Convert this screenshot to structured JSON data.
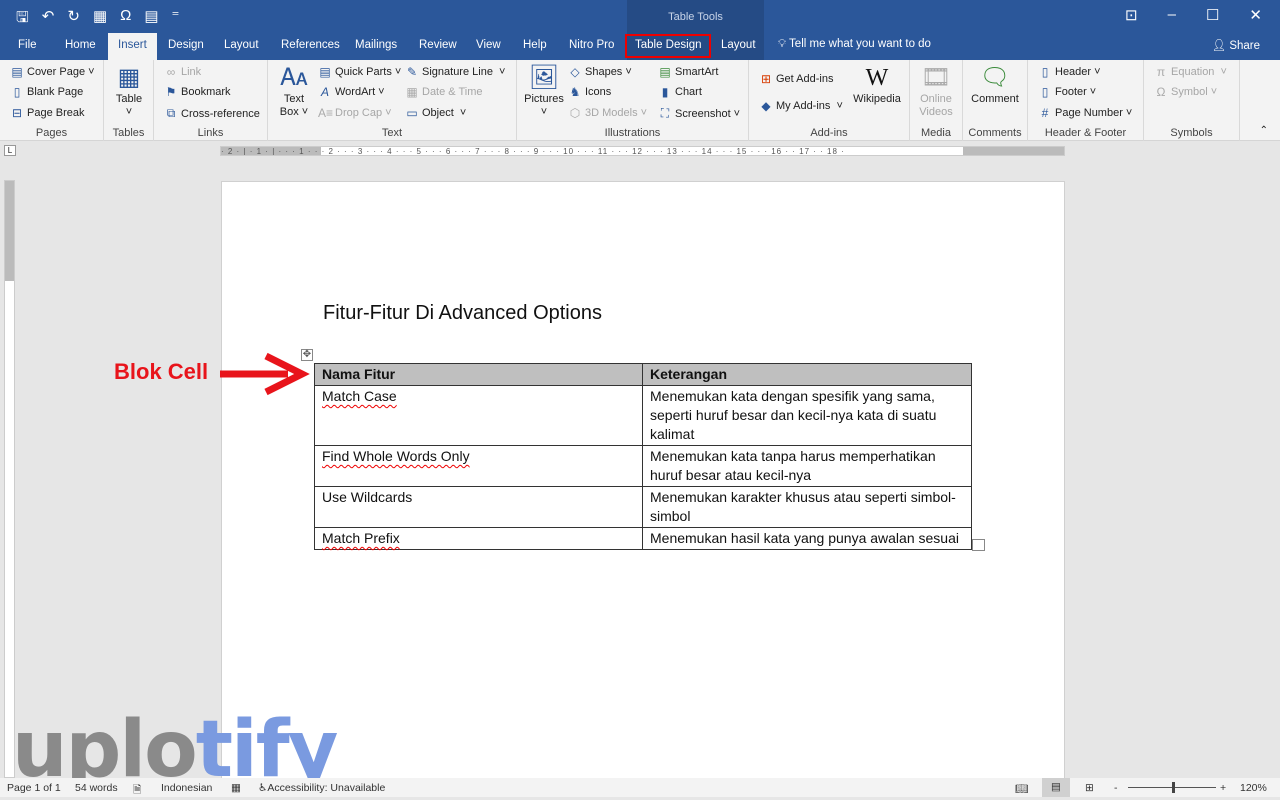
{
  "titlebar": {
    "context_group": "Table Tools",
    "qat": [
      {
        "icon": "save-icon",
        "glyph": "🖫"
      },
      {
        "icon": "undo-icon",
        "glyph": "↶"
      },
      {
        "icon": "redo-icon",
        "glyph": "↻"
      },
      {
        "icon": "table-insert-icon",
        "glyph": "▦"
      },
      {
        "icon": "omega-icon",
        "glyph": "Ω"
      },
      {
        "icon": "document-icon",
        "glyph": "▤"
      },
      {
        "icon": "customize-icon",
        "glyph": "⁼"
      }
    ],
    "window_buttons": [
      {
        "icon": "ribbon-display-icon",
        "glyph": "⊡"
      },
      {
        "icon": "minimize-icon",
        "glyph": "–"
      },
      {
        "icon": "maximize-icon",
        "glyph": "☐"
      },
      {
        "icon": "close-icon",
        "glyph": "✕"
      }
    ]
  },
  "tabs": [
    "File",
    "Home",
    "Insert",
    "Design",
    "Layout",
    "References",
    "Mailings",
    "Review",
    "View",
    "Help",
    "Nitro Pro",
    "Table Design",
    "Layout"
  ],
  "active_tab": "Insert",
  "highlighted_tab": "Table Design",
  "highlight_color": "#e00000",
  "tell_me": "Tell me what you want to do",
  "share": "Share",
  "ribbon": {
    "pages": {
      "label": "Pages",
      "items": [
        "Cover Page",
        "Blank Page",
        "Page Break"
      ]
    },
    "tables": {
      "label": "Tables",
      "items": [
        "Table"
      ]
    },
    "links": {
      "label": "Links",
      "items": [
        "Link",
        "Bookmark",
        "Cross-reference"
      ]
    },
    "text": {
      "label": "Text",
      "items": [
        "Text Box",
        "Quick Parts",
        "WordArt",
        "Drop Cap",
        "Signature Line",
        "Date & Time",
        "Object"
      ]
    },
    "illustrations": {
      "label": "Illustrations",
      "items": [
        "Pictures",
        "Shapes",
        "Icons",
        "3D Models",
        "SmartArt",
        "Chart",
        "Screenshot"
      ]
    },
    "addins": {
      "label": "Add-ins",
      "items": [
        "Get Add-ins",
        "My Add-ins",
        "Wikipedia"
      ]
    },
    "media": {
      "label": "Media",
      "items": [
        "Online Videos"
      ]
    },
    "comments": {
      "label": "Comments",
      "items": [
        "Comment"
      ]
    },
    "header_footer": {
      "label": "Header & Footer",
      "items": [
        "Header",
        "Footer",
        "Page Number"
      ]
    },
    "symbols": {
      "label": "Symbols",
      "items": [
        "Equation",
        "Symbol"
      ]
    }
  },
  "ruler": "· 2 · | · 1 · | · · · 1 · · · 2 · · · 3 · · · 4 · · · 5 · · · 6 · · · 7 · · · 8 · · · 9 · · · 10 · · · 11 · · · 12 · · · 13 · · · 14 · · · 15 · · · 16 · · 17 · · 18 ·",
  "document": {
    "title": "Fitur-Fitur Di Advanced Options",
    "table": {
      "headers": [
        "Nama Fitur",
        "Keterangan"
      ],
      "rows": [
        [
          "Match Case",
          "Menemukan kata dengan spesifik yang sama, seperti huruf besar dan kecil-nya kata di suatu kalimat"
        ],
        [
          "Find Whole Words Only",
          "Menemukan kata tanpa harus memperhatikan huruf besar atau kecil-nya"
        ],
        [
          "Use Wildcards",
          "Menemukan karakter khusus atau seperti simbol-simbol"
        ],
        [
          "Match Prefix",
          "Menemukan hasil kata yang punya awalan sesuai"
        ]
      ]
    }
  },
  "annotation": {
    "label": "Blok Cell",
    "color": "#e8141b"
  },
  "watermark": "uplotify",
  "status": {
    "page": "Page 1 of 1",
    "words": "54 words",
    "language": "Indonesian",
    "accessibility": "Accessibility: Unavailable",
    "zoom": "120%",
    "zoom_minus": "-",
    "zoom_plus": "+"
  }
}
